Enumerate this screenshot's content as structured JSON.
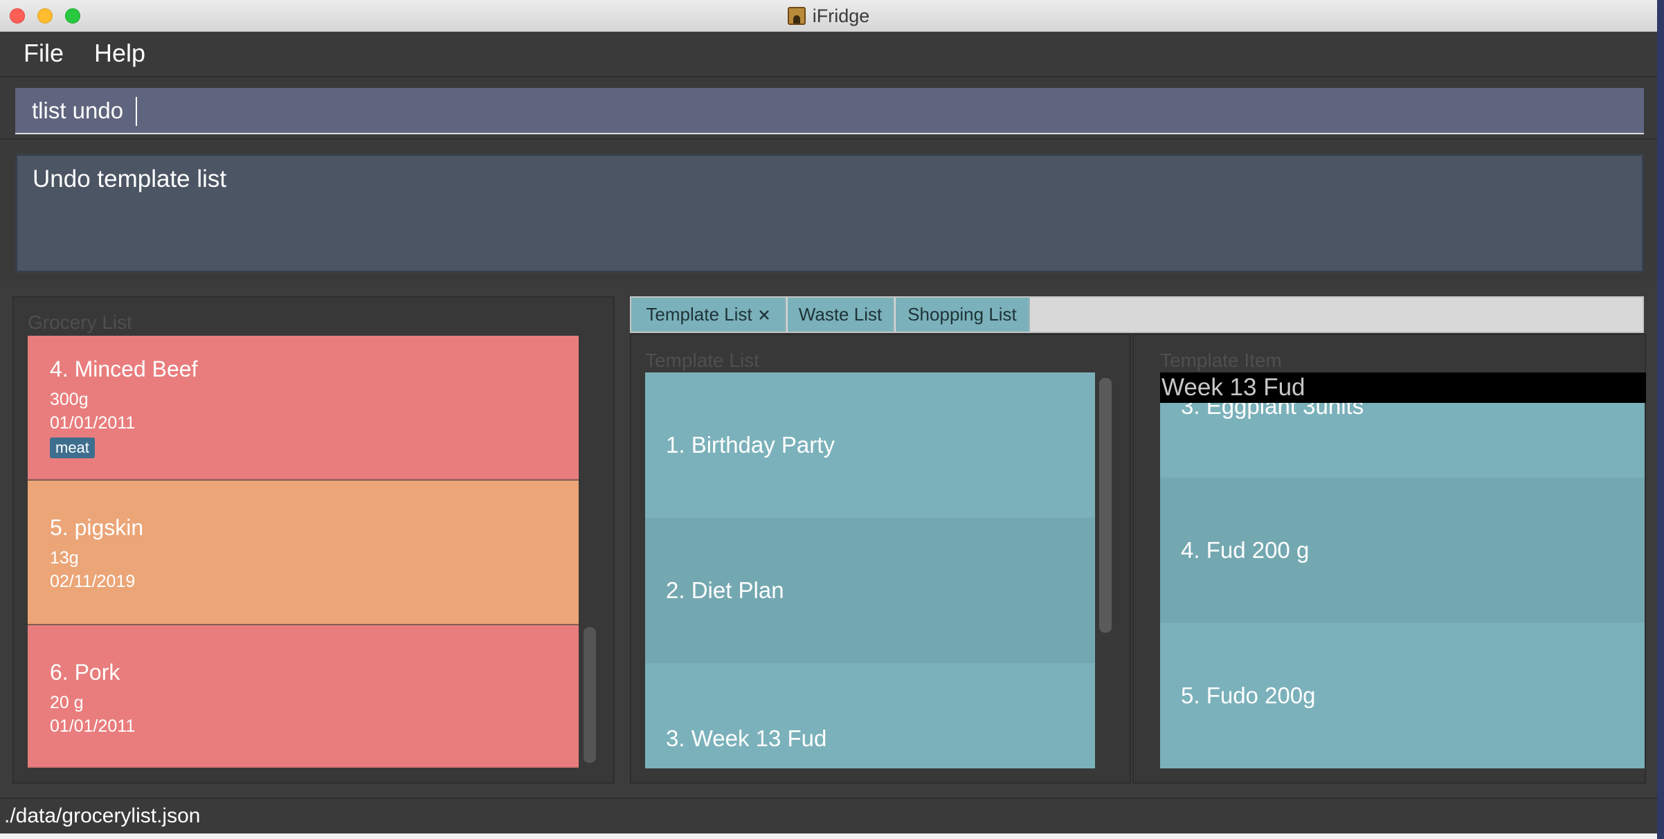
{
  "window": {
    "title": "iFridge",
    "icon": "app-icon",
    "traffic_lights": {
      "close": "#ff5f57",
      "minimize": "#febc2e",
      "zoom": "#28c840"
    }
  },
  "menu": {
    "file": "File",
    "help": "Help"
  },
  "command": {
    "value": "tlist undo"
  },
  "result": {
    "text": "Undo template list"
  },
  "grocery": {
    "title": "Grocery List",
    "items": [
      {
        "name": "4.  Minced Beef",
        "amount": "300g",
        "date": "01/01/2011",
        "tag": "meat",
        "color": "#e97d7d"
      },
      {
        "name": "5.  pigskin",
        "amount": "13g",
        "date": "02/11/2019",
        "color": "#eba577"
      },
      {
        "name": "6.  Pork",
        "amount": "20 g",
        "date": "01/01/2011",
        "color": "#e97d7d"
      }
    ]
  },
  "tabs": [
    {
      "label": "Template List",
      "close_icon": "close-icon"
    },
    {
      "label": "Waste List"
    },
    {
      "label": "Shopping List"
    }
  ],
  "template_list": {
    "title": "Template List",
    "items": [
      "1.  Birthday Party",
      "2.  Diet Plan",
      "3.  Week 13 Fud"
    ]
  },
  "template_item": {
    "title": "Template Item",
    "heading": "Week 13 Fud",
    "items": [
      "3.  Eggplant 3units",
      "4.  Fud 200 g",
      "5.  Fudo 200g"
    ]
  },
  "status": {
    "path": "./data/grocerylist.json"
  },
  "colors": {
    "teal": "#7bb1ba",
    "teal_alt": "#74a8b1",
    "panel": "#383838",
    "input": "#5f657e",
    "result": "#4c5564"
  }
}
